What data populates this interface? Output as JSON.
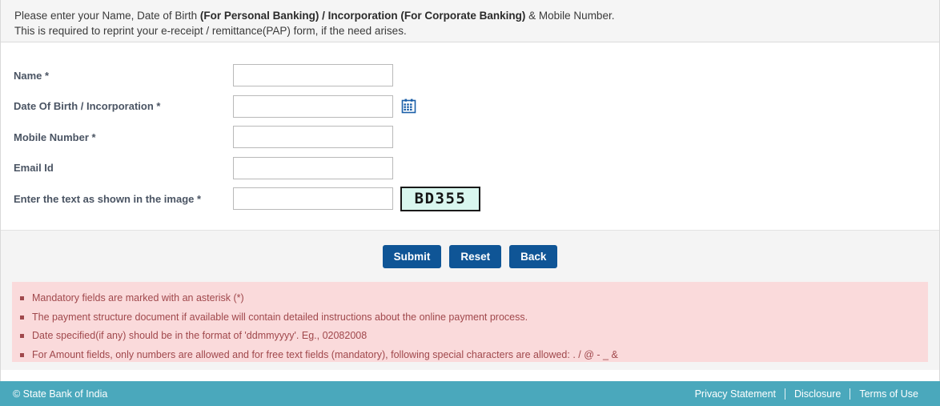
{
  "instructions": {
    "line1_part1": "Please enter your Name, Date of Birth ",
    "line1_bold": "(For Personal Banking) / Incorporation (For Corporate Banking)",
    "line1_part2": " & Mobile Number.",
    "line2": "This is required to reprint your e-receipt / remittance(PAP) form, if the need arises."
  },
  "form": {
    "fields": [
      {
        "label": "Name *",
        "value": "",
        "placeholder": ""
      },
      {
        "label": "Date Of Birth / Incorporation *",
        "value": "",
        "placeholder": ""
      },
      {
        "label": "Mobile Number *",
        "value": "",
        "placeholder": ""
      },
      {
        "label": "Email Id",
        "value": "",
        "placeholder": ""
      },
      {
        "label": "Enter the text as shown in the image *",
        "value": "",
        "placeholder": ""
      }
    ],
    "calendar_icon": "calendar-icon",
    "captcha_text": "BD355"
  },
  "buttons": {
    "submit": "Submit",
    "reset": "Reset",
    "back": "Back"
  },
  "notes": [
    "Mandatory fields are marked with an asterisk (*)",
    "The payment structure document if available will contain detailed instructions about the online payment process.",
    "Date specified(if any) should be in the format of 'ddmmyyyy'. Eg., 02082008",
    "For Amount fields, only numbers are allowed and for free text fields (mandatory), following special characters are allowed: . / @ - _ &"
  ],
  "footer": {
    "copyright": "© State Bank of India",
    "links": [
      "Privacy Statement",
      "Disclosure",
      "Terms of Use"
    ]
  },
  "colors": {
    "button_blue": "#0f5596",
    "footer_teal": "#4aa8bc",
    "notes_pink": "#fadadb",
    "notes_text": "#a0484c",
    "captcha_bg": "#d9f7ef"
  }
}
